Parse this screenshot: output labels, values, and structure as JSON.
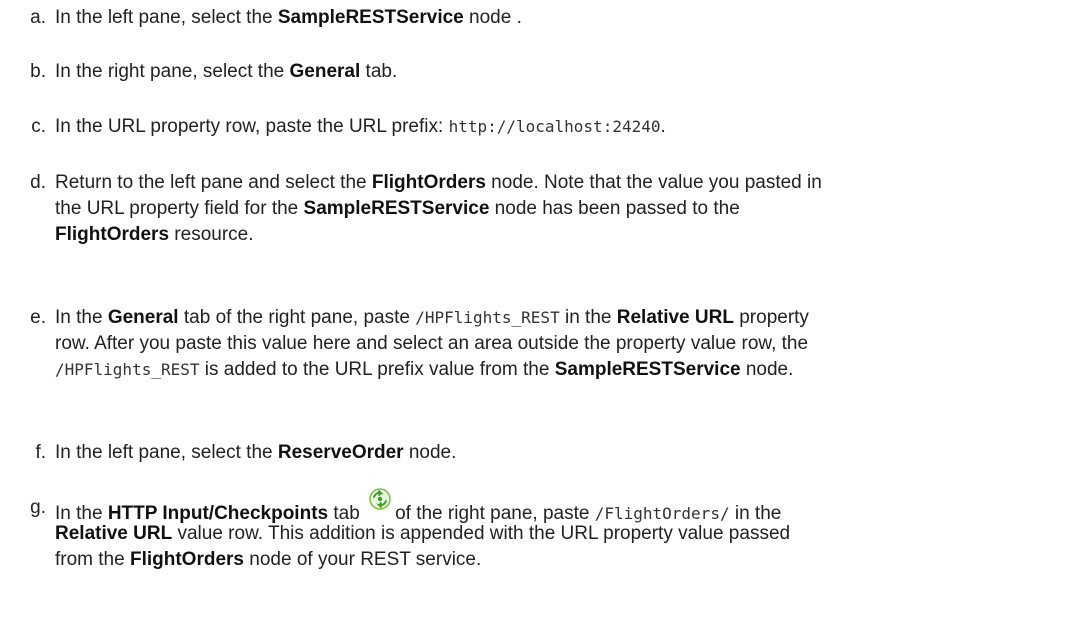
{
  "steps": [
    {
      "letter": "a.",
      "lines": [
        [
          {
            "t": "In the left pane, select the "
          },
          {
            "t": "SampleRESTService",
            "s": "b"
          },
          {
            "t": " node ."
          }
        ]
      ]
    },
    {
      "letter": "b.",
      "lines": [
        [
          {
            "t": "In the right pane, select the "
          },
          {
            "t": "General",
            "s": "b"
          },
          {
            "t": " tab."
          }
        ]
      ]
    },
    {
      "letter": "c.",
      "lines": [
        [
          {
            "t": "In the URL property row, paste the URL prefix: "
          },
          {
            "t": "http://localhost:24240",
            "s": "code"
          },
          {
            "t": "."
          }
        ]
      ]
    },
    {
      "letter": "d.",
      "lines": [
        [
          {
            "t": "Return to the left pane and select the "
          },
          {
            "t": "FlightOrders",
            "s": "b"
          },
          {
            "t": " node. Note that the value you pasted in"
          }
        ],
        [
          {
            "t": "the URL property field for the "
          },
          {
            "t": "SampleRESTService",
            "s": "b"
          },
          {
            "t": " node has been passed to the"
          }
        ],
        [
          {
            "t": "FlightOrders",
            "s": "b"
          },
          {
            "t": " resource."
          }
        ]
      ]
    },
    {
      "letter": "e.",
      "lines": [
        [
          {
            "t": "In the "
          },
          {
            "t": "General",
            "s": "b"
          },
          {
            "t": " tab of the right pane, paste "
          },
          {
            "t": "/HPFlights_REST",
            "s": "code"
          },
          {
            "t": " in the "
          },
          {
            "t": "Relative URL",
            "s": "b"
          },
          {
            "t": " property"
          }
        ],
        [
          {
            "t": "row. After you paste this value here and select an area outside the property value row, the"
          }
        ],
        [
          {
            "t": "/HPFlights_REST",
            "s": "code"
          },
          {
            "t": " is added to the URL prefix value from the "
          },
          {
            "t": "SampleRESTService",
            "s": "b"
          },
          {
            "t": " node."
          }
        ]
      ]
    },
    {
      "letter": "f.",
      "lines": [
        [
          {
            "t": "In the left pane, select the "
          },
          {
            "t": "ReserveOrder",
            "s": "b"
          },
          {
            "t": " node."
          }
        ]
      ]
    },
    {
      "letter": "g.",
      "lines": [
        [
          {
            "t": "In the "
          },
          {
            "t": "HTTP Input/Checkpoints",
            "s": "b"
          },
          {
            "t": " tab "
          },
          {
            "icon": "checkpoint-tab-icon"
          },
          {
            "t": "of the right pane, paste "
          },
          {
            "t": "/FlightOrders/",
            "s": "code"
          },
          {
            "t": " in the"
          }
        ],
        [
          {
            "t": "Relative URL",
            "s": "b"
          },
          {
            "t": " value row. This addition is appended with the URL property value passed"
          }
        ],
        [
          {
            "t": "from the "
          },
          {
            "t": "FlightOrders",
            "s": "b"
          },
          {
            "t": " node of your REST service."
          }
        ]
      ]
    }
  ]
}
